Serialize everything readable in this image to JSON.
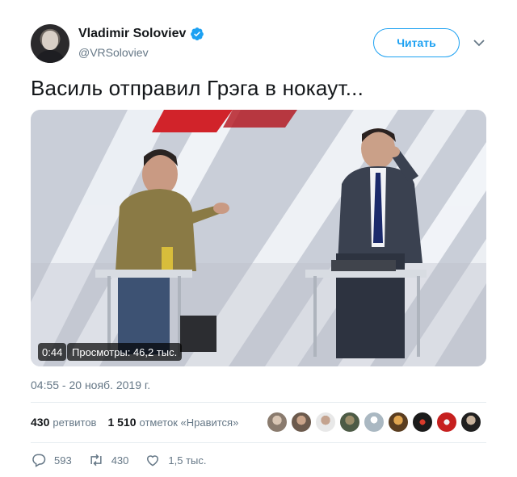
{
  "author": {
    "name": "Vladimir Soloviev",
    "handle": "@VRSoloviev",
    "verified": true
  },
  "follow_button": "Читать",
  "tweet_text": "Василь отправил Грэга в нокаут...",
  "video": {
    "duration": "0:44",
    "views": "Просмотры: 46,2 тыс."
  },
  "timestamp": "04:55 - 20 нояб. 2019 г.",
  "stats": {
    "retweets_count": "430",
    "retweets_label": "ретвитов",
    "likes_count": "1 510",
    "likes_label": "отметок «Нравится»"
  },
  "actions": {
    "replies": "593",
    "retweets": "430",
    "likes": "1,5 тыс."
  },
  "colors": {
    "accent": "#1da1f2",
    "secondary_text": "#657786"
  },
  "icons": [
    "verified-badge-icon",
    "chevron-down-icon",
    "reply-icon",
    "retweet-icon",
    "like-icon"
  ]
}
